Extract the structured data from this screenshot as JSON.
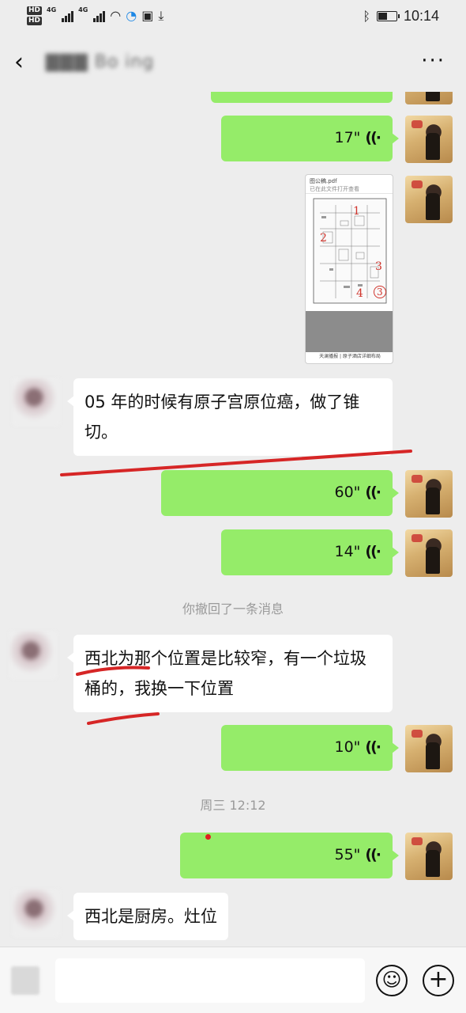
{
  "status_bar": {
    "hd1": "HD",
    "hd2": "HD",
    "net1": "4G",
    "net2": "4G",
    "time": "10:14",
    "battery_level": 0.5
  },
  "header": {
    "back_icon": "chevron-left-icon",
    "contact_name": "▇▇▇ Bo ing",
    "more_icon": "more-dots-icon"
  },
  "messages": {
    "voice1_duration": "17\"",
    "pdf_title": "图公稿.pdf",
    "pdf_subtitle": "已在此文件打开查看",
    "pdf_footer": "天澜播报 | 原子酒店详细布局",
    "pdf_marks": [
      "1",
      "2",
      "3",
      "4",
      "3"
    ],
    "text1": "05 年的时候有原子宫原位癌，做了锥切。",
    "voice2_duration": "60\"",
    "voice3_duration": "14\"",
    "recall_notice": "你撤回了一条消息",
    "text2": "西北为那个位置是比较窄，有一个垃圾桶的，我换一下位置",
    "voice4_duration": "10\"",
    "timestamp": "周三 12:12",
    "voice5_duration": "55\"",
    "text3": "西北是厨房。灶位"
  },
  "input_bar": {
    "emoji_icon": "emoji-icon",
    "plus_icon": "plus-icon"
  },
  "colors": {
    "background": "#ededed",
    "my_bubble": "#95ec69",
    "their_bubble": "#ffffff",
    "annotation_red": "#d62626"
  }
}
